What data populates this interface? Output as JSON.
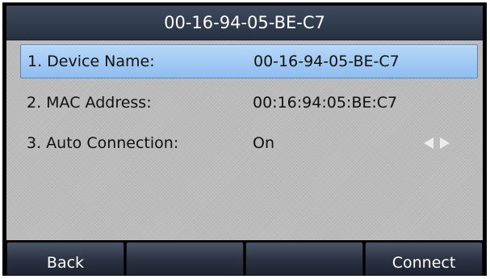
{
  "header": {
    "title": "00-16-94-05-BE-C7"
  },
  "settings": {
    "rows": [
      {
        "label": "1. Device Name:",
        "value": "00-16-94-05-BE-C7",
        "selected": true
      },
      {
        "label": "2. MAC Address:",
        "value": "00:16:94:05:BE:C7",
        "selected": false
      },
      {
        "label": "3. Auto Connection:",
        "value": "On",
        "selected": false,
        "has_arrows": true
      }
    ]
  },
  "softkeys": {
    "back": "Back",
    "key2": "",
    "key3": "",
    "connect": "Connect"
  },
  "icons": {
    "prev": "arrow-left-icon",
    "next": "arrow-right-icon"
  },
  "colors": {
    "selection": "#a6ccf4",
    "title_bar": "#2f3948",
    "background": "#bcbcbc"
  }
}
